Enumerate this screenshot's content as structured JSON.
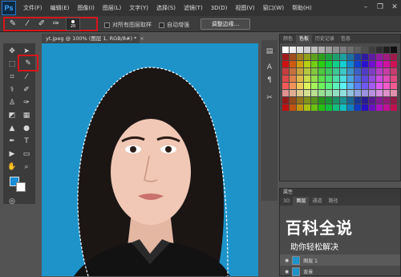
{
  "menubar": {
    "logo": "Ps",
    "items": [
      "文件(F)",
      "编辑(E)",
      "图像(I)",
      "图层(L)",
      "文字(Y)",
      "选择(S)",
      "滤镜(T)",
      "3D(D)",
      "视图(V)",
      "窗口(W)",
      "帮助(H)"
    ],
    "window_controls": [
      "minimize-icon",
      "restore-icon",
      "close-icon"
    ]
  },
  "options": {
    "brush_size": "20",
    "sample_all_layers": "对所有图层取样",
    "auto_enhance": "自动增强",
    "refine_edge": "调整边缘..."
  },
  "document": {
    "tab_title": "yt.jpeg @ 100% (图层 1, RGB/8#) *",
    "tab_close": "×"
  },
  "colors": {
    "foreground": "#1a8ed8",
    "background": "#ffffff",
    "canvas_bg": "#1e93c9",
    "highlight": "#d7141b"
  },
  "swatches_panel": {
    "tabs": [
      "颜色",
      "色板",
      "历史记录",
      "信息"
    ],
    "active_tab": "色板"
  },
  "layers_panel": {
    "properties_header": "属性",
    "tabs": [
      "3D",
      "图层",
      "通道",
      "路径"
    ],
    "active_tab": "图层",
    "layers": [
      {
        "name": "图层 1"
      },
      {
        "name": "背景"
      }
    ]
  },
  "watermark": {
    "title": "百科全说",
    "subtitle": "助你轻松解决"
  }
}
